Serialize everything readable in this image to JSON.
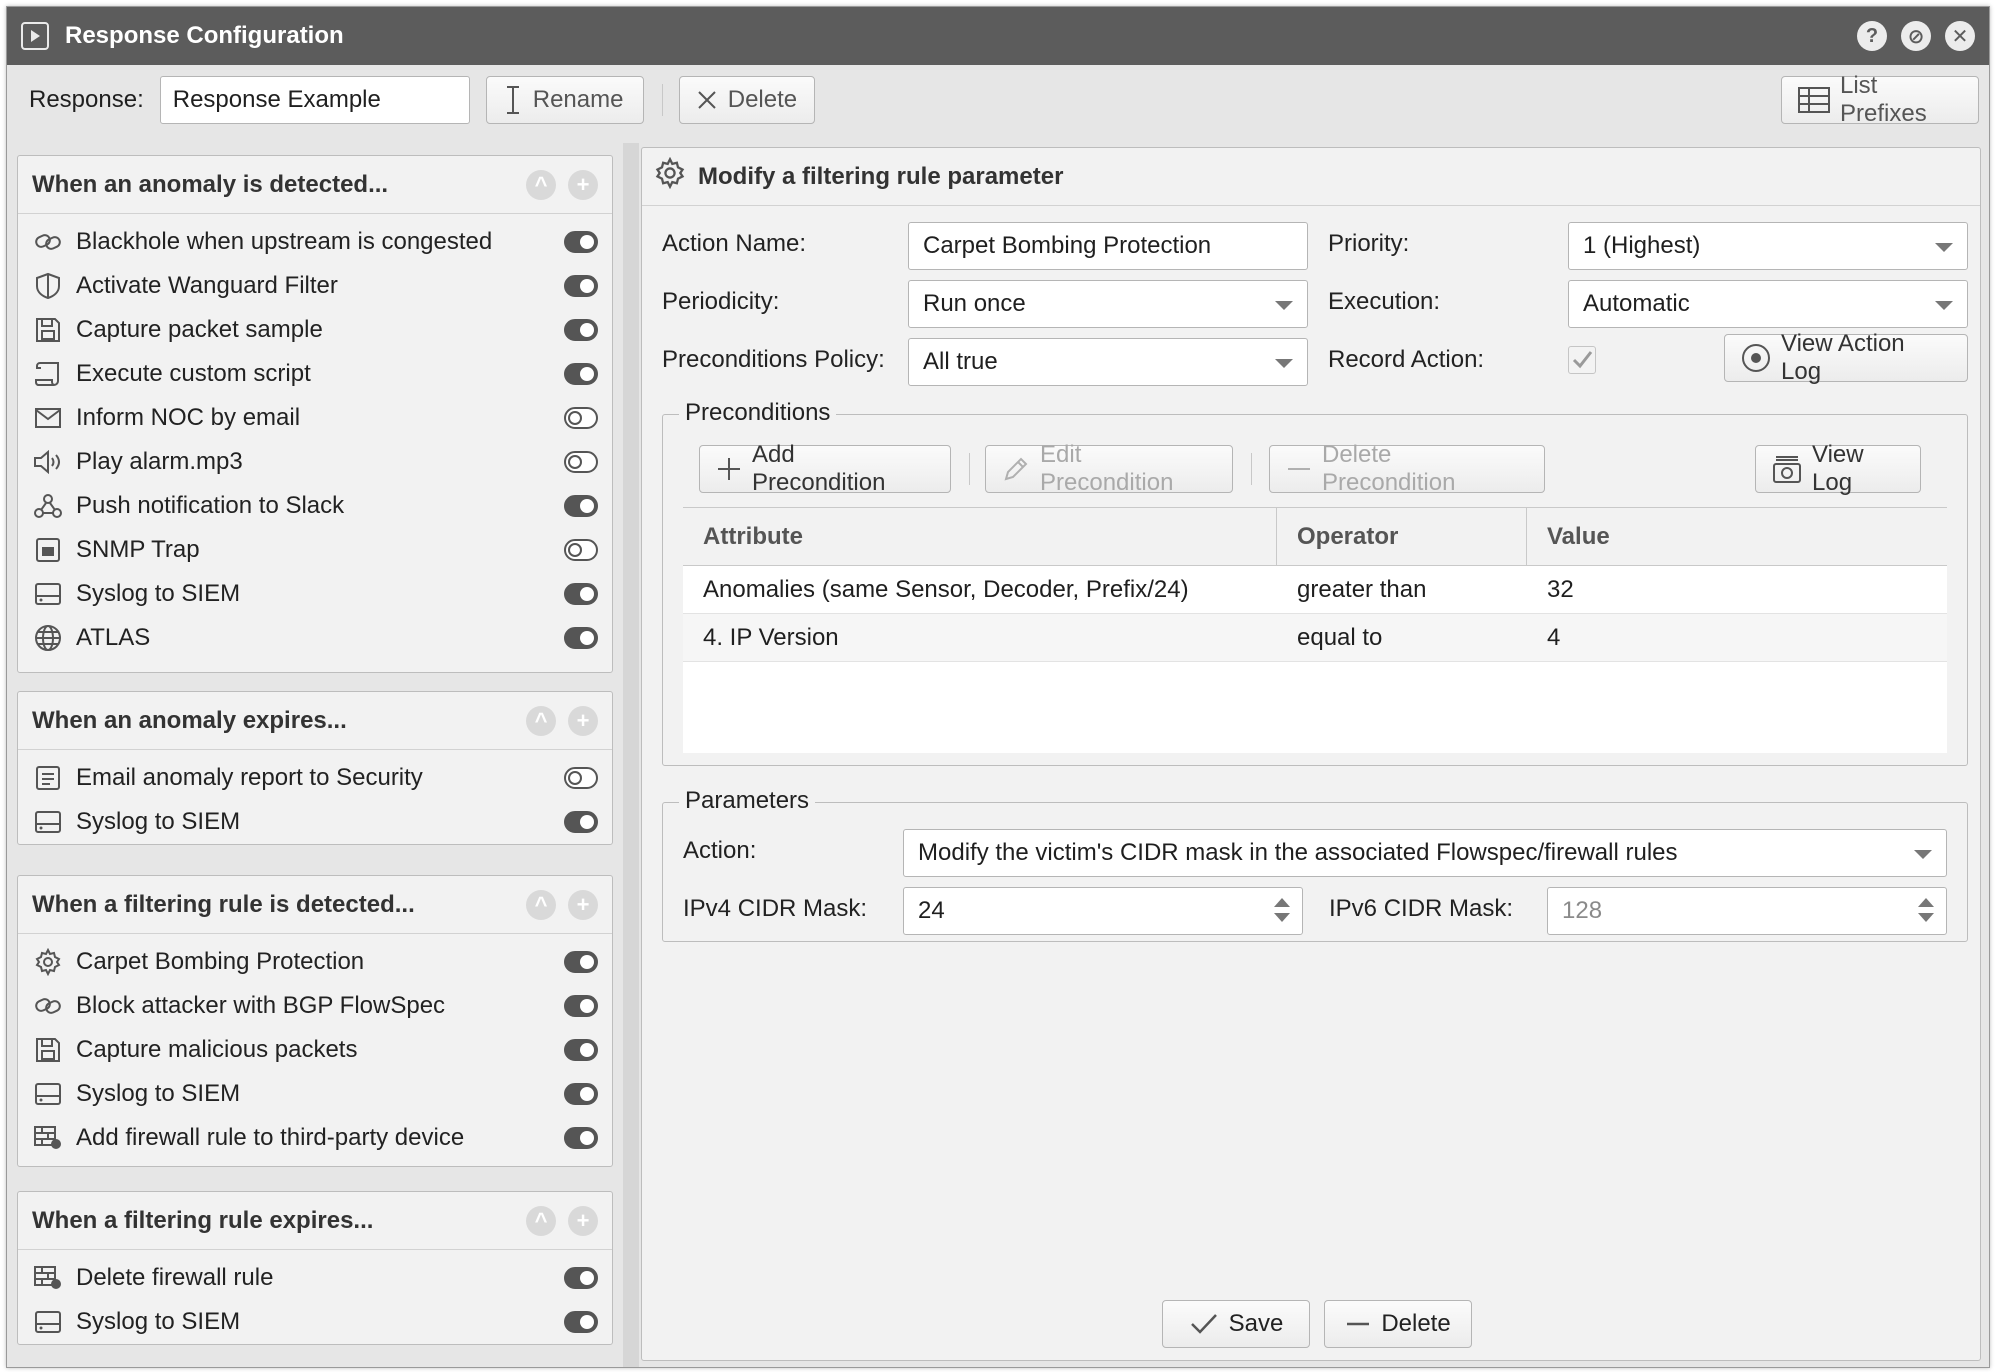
{
  "window": {
    "title": "Response Configuration",
    "buttons": [
      "?",
      "⊘",
      "✕"
    ]
  },
  "toolbar": {
    "response_label": "Response:",
    "response_value": "Response Example",
    "rename_label": "Rename",
    "delete_label": "Delete",
    "list_prefixes_label": "List Prefixes"
  },
  "groups": [
    {
      "title": "When an anomaly is detected...",
      "items": [
        {
          "label": "Blackhole when upstream is congested",
          "icon": "link-icon",
          "enabled": true
        },
        {
          "label": "Activate Wanguard Filter",
          "icon": "shield-icon",
          "enabled": true
        },
        {
          "label": "Capture packet sample",
          "icon": "floppy-icon",
          "enabled": true
        },
        {
          "label": "Execute custom script",
          "icon": "script-icon",
          "enabled": true
        },
        {
          "label": "Inform NOC by email",
          "icon": "envelope-icon",
          "enabled": false
        },
        {
          "label": "Play alarm.mp3",
          "icon": "speaker-icon",
          "enabled": false
        },
        {
          "label": "Push notification to Slack",
          "icon": "webhook-icon",
          "enabled": true
        },
        {
          "label": "SNMP Trap",
          "icon": "snmp-icon",
          "enabled": false
        },
        {
          "label": "Syslog to SIEM",
          "icon": "server-icon",
          "enabled": true
        },
        {
          "label": "ATLAS",
          "icon": "globe-icon",
          "enabled": true
        }
      ]
    },
    {
      "title": "When an anomaly expires...",
      "items": [
        {
          "label": "Email anomaly report to Security",
          "icon": "report-icon",
          "enabled": false
        },
        {
          "label": "Syslog to SIEM",
          "icon": "server-icon",
          "enabled": true
        }
      ]
    },
    {
      "title": "When a filtering rule is detected...",
      "items": [
        {
          "label": "Carpet Bombing Protection",
          "icon": "gear-icon",
          "enabled": true
        },
        {
          "label": "Block attacker with BGP FlowSpec",
          "icon": "link-icon",
          "enabled": true
        },
        {
          "label": "Capture malicious packets",
          "icon": "floppy-icon",
          "enabled": true
        },
        {
          "label": "Syslog to SIEM",
          "icon": "server-icon",
          "enabled": true
        },
        {
          "label": "Add firewall rule to third-party device",
          "icon": "firewall-icon",
          "enabled": true
        }
      ]
    },
    {
      "title": "When a filtering rule expires...",
      "items": [
        {
          "label": "Delete firewall rule",
          "icon": "firewall-icon",
          "enabled": true
        },
        {
          "label": "Syslog to SIEM",
          "icon": "server-icon",
          "enabled": true
        }
      ]
    }
  ],
  "editor": {
    "title": "Modify a filtering rule parameter",
    "action_name_label": "Action Name:",
    "action_name_value": "Carpet Bombing Protection",
    "priority_label": "Priority:",
    "priority_value": "1 (Highest)",
    "periodicity_label": "Periodicity:",
    "periodicity_value": "Run once",
    "execution_label": "Execution:",
    "execution_value": "Automatic",
    "preconditions_policy_label": "Preconditions Policy:",
    "preconditions_policy_value": "All true",
    "record_action_label": "Record Action:",
    "record_action_checked": true,
    "view_action_log_label": "View Action Log",
    "preconditions": {
      "legend": "Preconditions",
      "add_label": "Add Precondition",
      "edit_label": "Edit Precondition",
      "delete_label": "Delete Precondition",
      "view_log_label": "View Log",
      "columns": [
        "Attribute",
        "Operator",
        "Value"
      ],
      "rows": [
        [
          "Anomalies (same Sensor, Decoder, Prefix/24)",
          "greater than",
          "32"
        ],
        [
          "4. IP Version",
          "equal to",
          "4"
        ]
      ]
    },
    "parameters": {
      "legend": "Parameters",
      "action_label": "Action:",
      "action_value": "Modify the victim's CIDR mask in the associated Flowspec/firewall rules",
      "ipv4_label": "IPv4 CIDR Mask:",
      "ipv4_value": "24",
      "ipv6_label": "IPv6 CIDR Mask:",
      "ipv6_value": "128"
    },
    "save_label": "Save",
    "delete_label": "Delete"
  }
}
